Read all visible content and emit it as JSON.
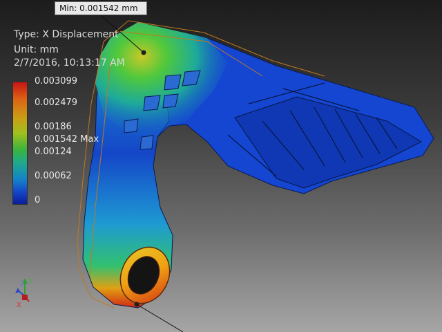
{
  "tooltip": {
    "min_label": "Min: 0.001542 mm"
  },
  "result_info": {
    "type": "Type: X Displacement",
    "unit": "Unit: mm",
    "timestamp": "2/7/2016, 10:13:17 AM"
  },
  "legend": {
    "labels": [
      "0.003099",
      "0.002479",
      "0.00186",
      "0.001542 Max",
      "0.00124",
      "0.00062",
      "0"
    ],
    "colors": [
      "#c81414",
      "#dc6414",
      "#c8a014",
      "#a0c01e",
      "#3cb43c",
      "#1eaa8c",
      "#1482c8",
      "#1446c8",
      "#0a1e9a"
    ]
  },
  "triad": {
    "x": "X",
    "y": "Y",
    "z": "Z"
  },
  "model": {
    "icon": "fea-displacement-model"
  }
}
